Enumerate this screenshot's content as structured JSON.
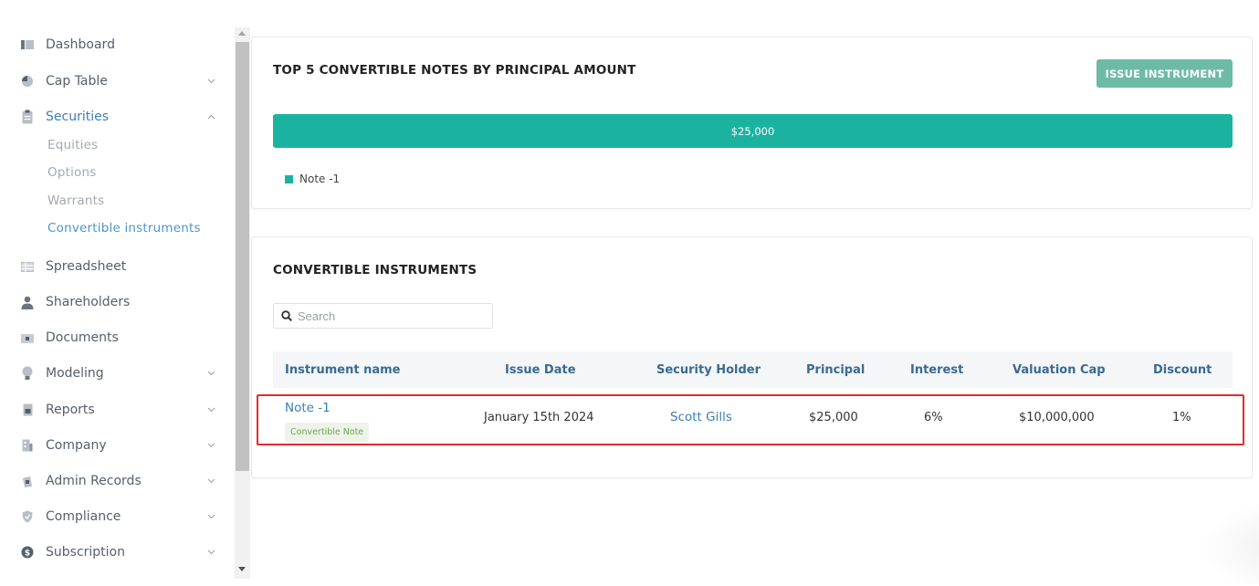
{
  "sidebar": {
    "items": [
      {
        "label": "Dashboard",
        "icon": "dashboard-icon"
      },
      {
        "label": "Cap Table",
        "icon": "pie-chart-icon"
      },
      {
        "label": "Securities",
        "icon": "clipboard-icon"
      },
      {
        "label": "Spreadsheet",
        "icon": "spreadsheet-icon"
      },
      {
        "label": "Shareholders",
        "icon": "person-icon"
      },
      {
        "label": "Documents",
        "icon": "folder-icon"
      },
      {
        "label": "Modeling",
        "icon": "lightbulb-icon"
      },
      {
        "label": "Reports",
        "icon": "report-icon"
      },
      {
        "label": "Company",
        "icon": "building-icon"
      },
      {
        "label": "Admin Records",
        "icon": "records-icon"
      },
      {
        "label": "Compliance",
        "icon": "shield-icon"
      },
      {
        "label": "Subscription",
        "icon": "dollar-icon"
      }
    ],
    "securities_sub": [
      "Equities",
      "Options",
      "Warrants",
      "Convertible instruments"
    ]
  },
  "top_card": {
    "title": "TOP 5 CONVERTIBLE NOTES BY PRINCIPAL AMOUNT",
    "issue_button": "ISSUE INSTRUMENT",
    "legend_label": "Note -1"
  },
  "chart_data": {
    "type": "bar",
    "orientation": "horizontal-stacked",
    "categories": [
      "Note -1"
    ],
    "values": [
      25000
    ],
    "data_labels": [
      "$25,000"
    ],
    "legend": [
      "Note -1"
    ],
    "color": "#1bb3a0"
  },
  "table_card": {
    "title": "CONVERTIBLE INSTRUMENTS",
    "search_placeholder": "Search",
    "columns": [
      "Instrument name",
      "Issue Date",
      "Security Holder",
      "Principal",
      "Interest",
      "Valuation Cap",
      "Discount"
    ],
    "rows": [
      {
        "name": "Note -1",
        "type_badge": "Convertible Note",
        "issue_date": "January 15th 2024",
        "holder": "Scott Gills",
        "principal": "$25,000",
        "interest": "6%",
        "valuation_cap": "$10,000,000",
        "discount": "1%"
      }
    ]
  },
  "colors": {
    "accent": "#1bb3a0",
    "button": "#6dbba4",
    "link": "#3a7fb3",
    "highlight_border": "#e32b2b"
  }
}
